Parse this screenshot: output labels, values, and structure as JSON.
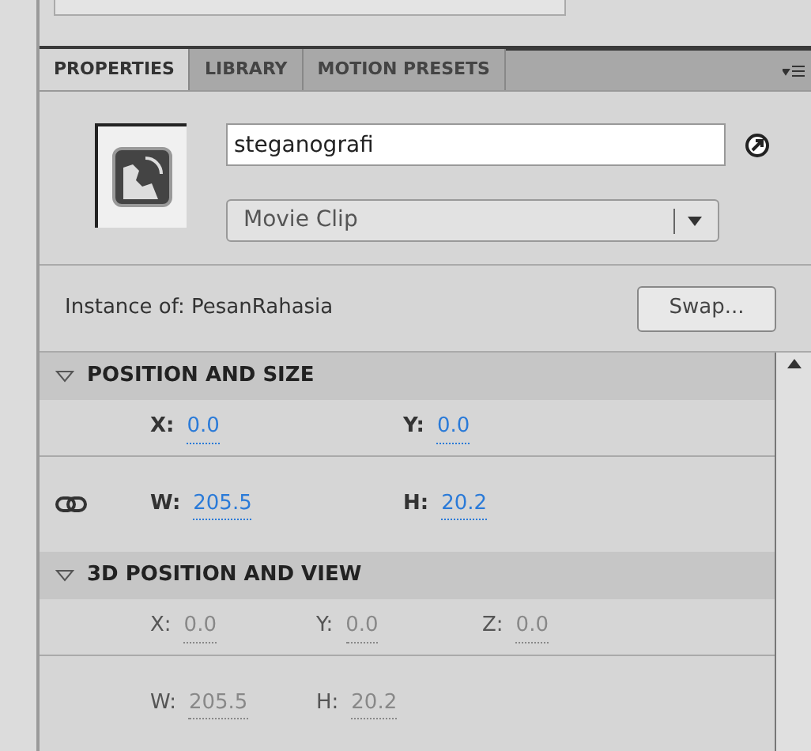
{
  "tabs": [
    {
      "label": "PROPERTIES",
      "selected": true
    },
    {
      "label": "LIBRARY",
      "selected": false
    },
    {
      "label": "MOTION PRESETS",
      "selected": false
    }
  ],
  "instance_name": {
    "value": "steganografi"
  },
  "symbol_type": {
    "value": "Movie Clip"
  },
  "instance_of": {
    "label": "Instance of:",
    "value": "PesanRahasia"
  },
  "swap_button": "Swap...",
  "sections": [
    {
      "title": "POSITION AND SIZE",
      "expanded": true,
      "rows": [
        {
          "linked": false,
          "fields": [
            {
              "label": "X:",
              "value": "0.0",
              "disabled": false
            },
            {
              "label": "Y:",
              "value": "0.0",
              "disabled": false
            }
          ]
        },
        {
          "linked": true,
          "fields": [
            {
              "label": "W:",
              "value": "205.5",
              "disabled": false
            },
            {
              "label": "H:",
              "value": "20.2",
              "disabled": false
            }
          ]
        }
      ]
    },
    {
      "title": "3D POSITION AND VIEW",
      "expanded": true,
      "rows": [
        {
          "linked": false,
          "fields": [
            {
              "label": "X:",
              "value": "0.0",
              "disabled": true
            },
            {
              "label": "Y:",
              "value": "0.0",
              "disabled": true
            },
            {
              "label": "Z:",
              "value": "0.0",
              "disabled": true
            }
          ]
        },
        {
          "linked": false,
          "fields": [
            {
              "label": "W:",
              "value": "205.5",
              "disabled": true
            },
            {
              "label": "H:",
              "value": "20.2",
              "disabled": true
            }
          ]
        }
      ]
    }
  ]
}
